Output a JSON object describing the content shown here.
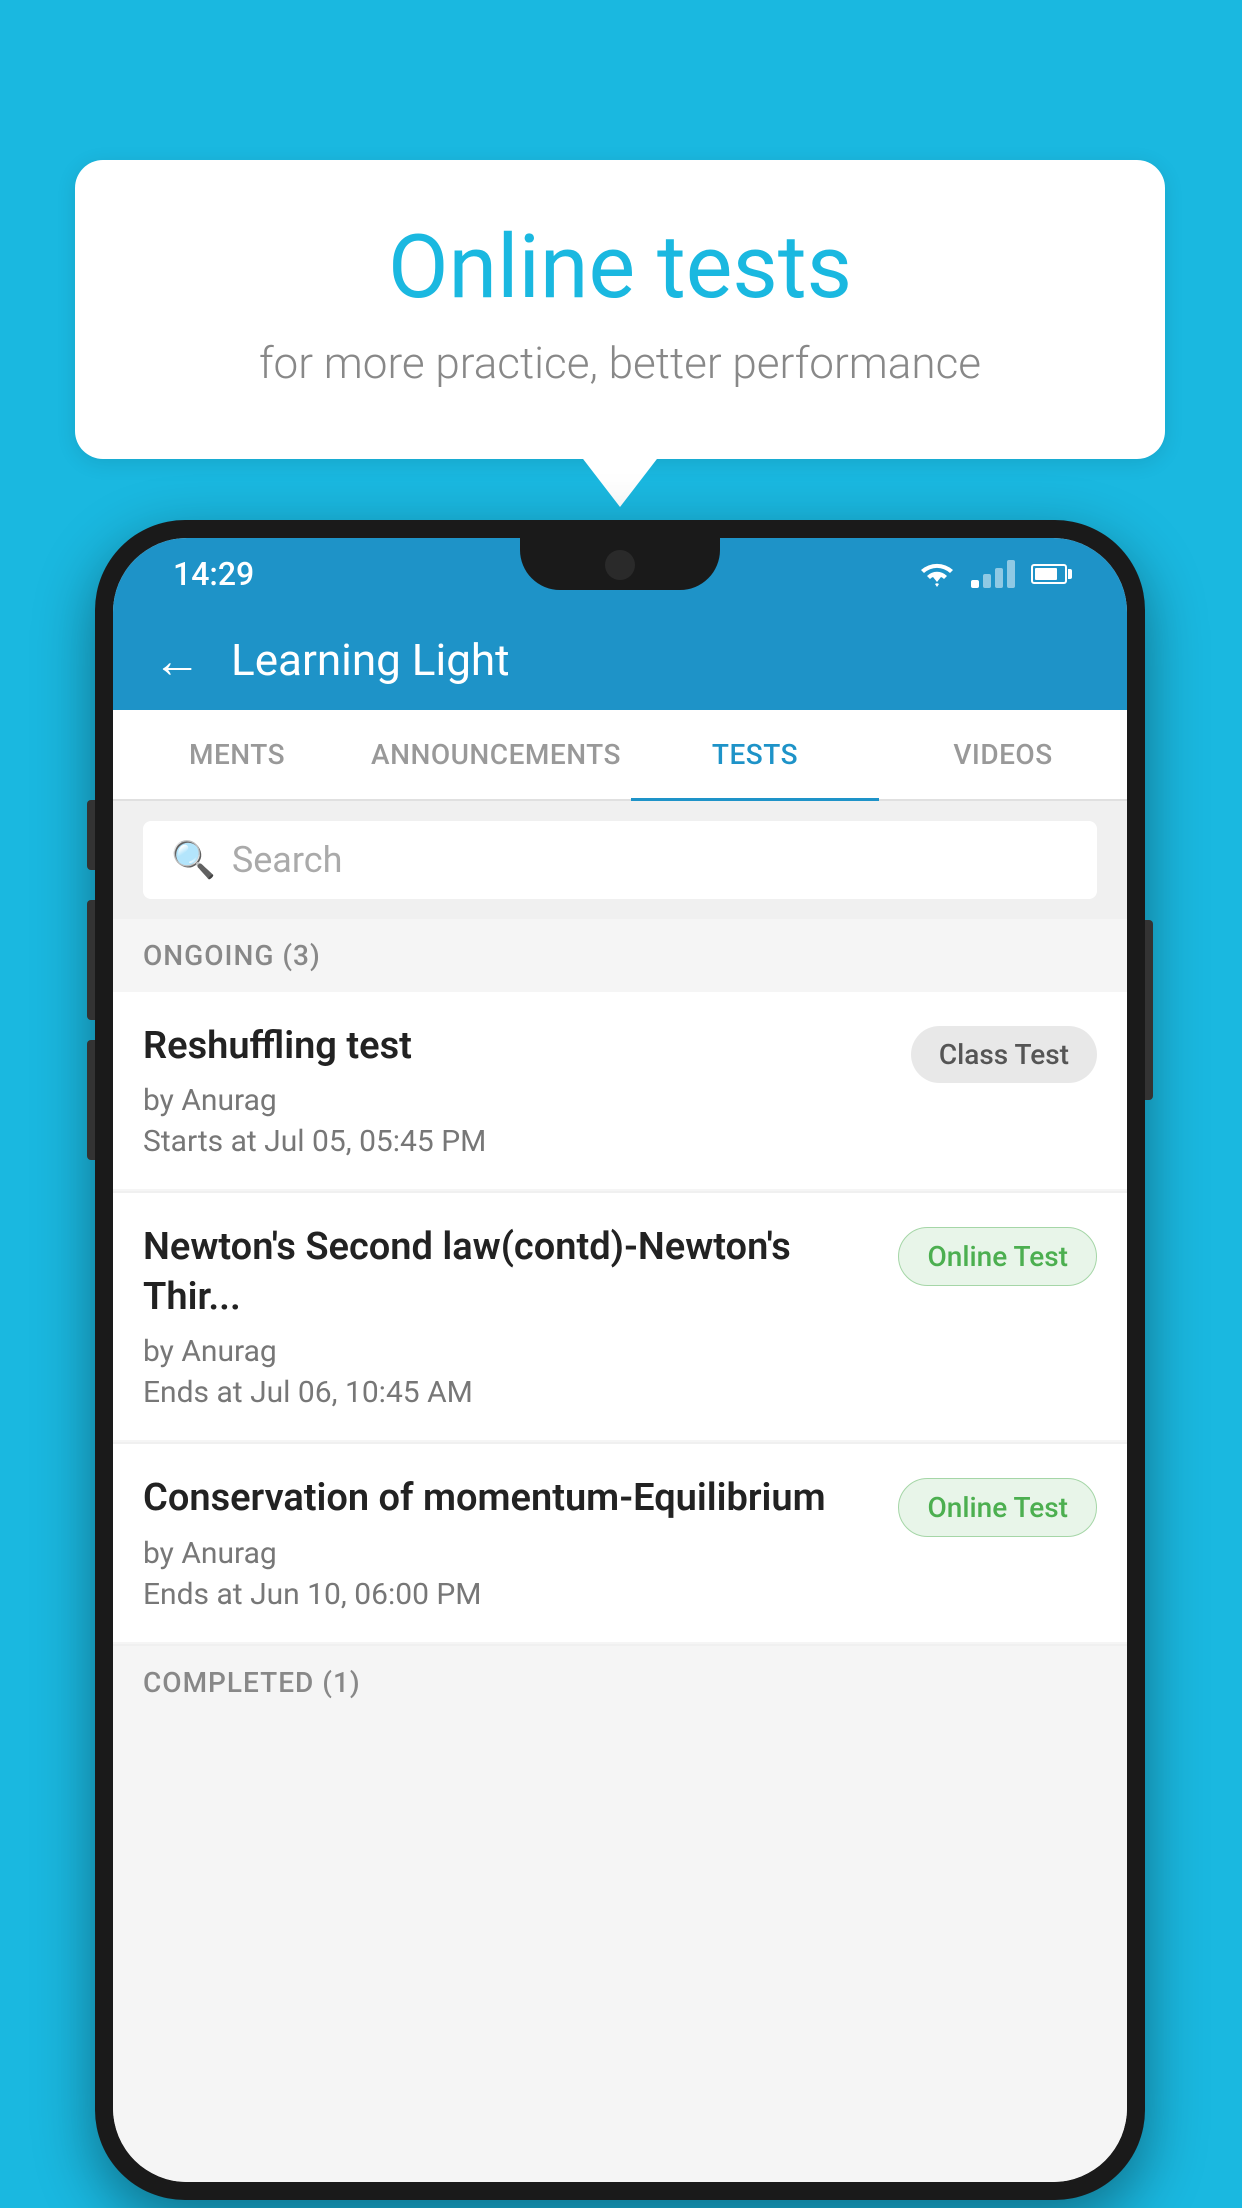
{
  "background_color": "#1ab8e0",
  "bubble": {
    "title": "Online tests",
    "subtitle": "for more practice, better performance"
  },
  "status_bar": {
    "time": "14:29",
    "wifi": "▼",
    "battery_percent": 80
  },
  "app_bar": {
    "back_label": "←",
    "title": "Learning Light"
  },
  "tabs": [
    {
      "label": "MENTS",
      "active": false
    },
    {
      "label": "ANNOUNCEMENTS",
      "active": false
    },
    {
      "label": "TESTS",
      "active": true
    },
    {
      "label": "VIDEOS",
      "active": false
    }
  ],
  "search": {
    "placeholder": "Search"
  },
  "ongoing_section": {
    "header": "ONGOING (3)",
    "items": [
      {
        "name": "Reshuffling test",
        "by": "by Anurag",
        "time_label": "Starts at",
        "time": "Jul 05, 05:45 PM",
        "badge": "Class Test",
        "badge_type": "class"
      },
      {
        "name": "Newton's Second law(contd)-Newton's Thir...",
        "by": "by Anurag",
        "time_label": "Ends at",
        "time": "Jul 06, 10:45 AM",
        "badge": "Online Test",
        "badge_type": "online"
      },
      {
        "name": "Conservation of momentum-Equilibrium",
        "by": "by Anurag",
        "time_label": "Ends at",
        "time": "Jun 10, 06:00 PM",
        "badge": "Online Test",
        "badge_type": "online"
      }
    ]
  },
  "completed_section": {
    "header": "COMPLETED (1)"
  }
}
